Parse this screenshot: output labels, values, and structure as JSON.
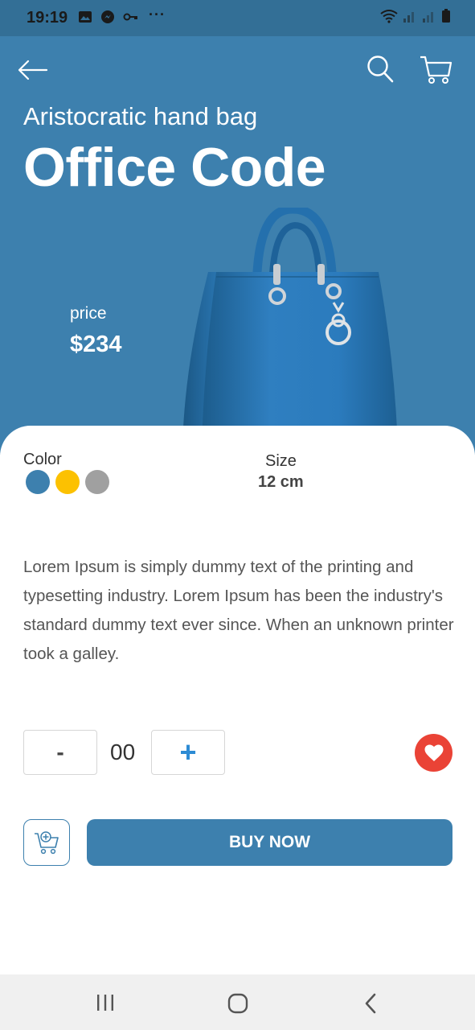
{
  "status_bar": {
    "time": "19:19",
    "more_dots": "···",
    "left_icons": [
      "gallery-icon",
      "messenger-icon",
      "key-icon"
    ],
    "right_icons": [
      "wifi-icon",
      "signal-icon",
      "signal-icon",
      "battery-icon"
    ]
  },
  "header": {
    "back_icon": "arrow-left-icon",
    "search_icon": "search-icon",
    "cart_icon": "cart-icon"
  },
  "product": {
    "subtitle": "Aristocratic hand bag",
    "title": "Office Code",
    "price_label": "price",
    "price": "$234",
    "image": "blue-handbag"
  },
  "details": {
    "color_label": "Color",
    "colors": [
      "#3d80ae",
      "#fcc101",
      "#a0a0a0"
    ],
    "size_label": "Size",
    "size_value": "12 cm",
    "description": "Lorem Ipsum is simply dummy text of the printing and typesetting industry. Lorem Ipsum has been the industry's standard dummy text ever since. When an unknown printer took a galley."
  },
  "quantity": {
    "minus_label": "-",
    "value": "00",
    "plus_label": "+"
  },
  "actions": {
    "favorite_icon": "heart-icon",
    "add_to_cart_icon": "cart-add-icon",
    "buy_label": "BUY NOW"
  },
  "colors": {
    "primary": "#3d80ae",
    "status_bar": "#336f96",
    "favorite": "#ea4336",
    "plus": "#2d8bd4"
  },
  "system_nav": [
    "recent-apps-icon",
    "home-icon",
    "back-icon"
  ]
}
